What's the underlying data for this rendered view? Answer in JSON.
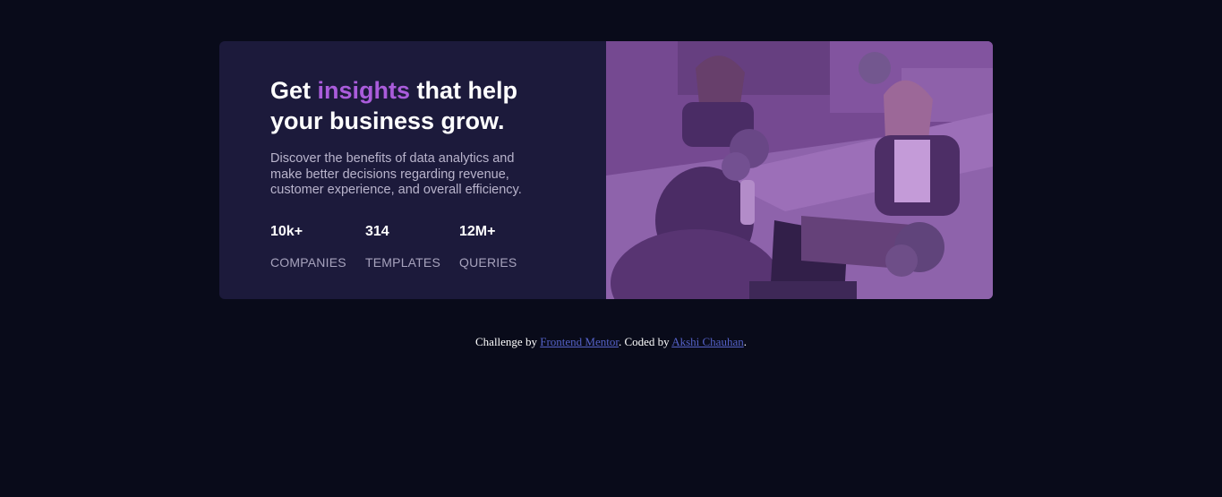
{
  "card": {
    "headline_pre": "Get ",
    "headline_accent": "insights",
    "headline_post": " that help your business grow.",
    "description": "Discover the benefits of data analytics and make better decisions regarding revenue, customer experience, and overall efficiency.",
    "stats": [
      {
        "value": "10k+",
        "label": "COMPANIES"
      },
      {
        "value": "314",
        "label": "TEMPLATES"
      },
      {
        "value": "12M+",
        "label": "QUERIES"
      }
    ],
    "image_description": "Photo of people working at a table with laptops, tinted purple"
  },
  "footer": {
    "prefix": "Challenge by ",
    "link1": "Frontend Mentor",
    "middle": ". Coded by ",
    "link2": "Akshi Chauhan",
    "suffix": "."
  },
  "colors": {
    "background": "#090b1a",
    "card": "#1c1a3b",
    "accent": "#aa5cdb",
    "link": "#5562c8"
  }
}
